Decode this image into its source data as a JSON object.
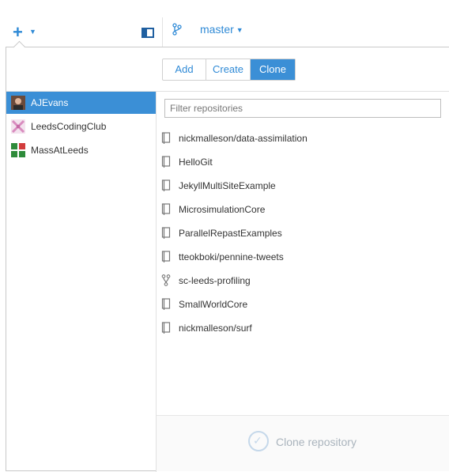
{
  "toolbar": {
    "branch_label": "master"
  },
  "tabs": [
    {
      "label": "Add"
    },
    {
      "label": "Create"
    },
    {
      "label": "Clone"
    }
  ],
  "accounts": [
    {
      "name": "AJEvans",
      "selected": true
    },
    {
      "name": "LeedsCodingClub",
      "selected": false
    },
    {
      "name": "MassAtLeeds",
      "selected": false
    }
  ],
  "filter": {
    "placeholder": "Filter repositories",
    "value": ""
  },
  "repositories": [
    {
      "name": "nickmalleson/data-assimilation",
      "icon": "repo-icon"
    },
    {
      "name": "HelloGit",
      "icon": "repo-icon"
    },
    {
      "name": "JekyllMultiSiteExample",
      "icon": "repo-icon"
    },
    {
      "name": "MicrosimulationCore",
      "icon": "repo-icon"
    },
    {
      "name": "ParallelRepastExamples",
      "icon": "repo-icon"
    },
    {
      "name": "tteokboki/pennine-tweets",
      "icon": "repo-icon"
    },
    {
      "name": "sc-leeds-profiling",
      "icon": "fork-icon"
    },
    {
      "name": "SmallWorldCore",
      "icon": "repo-icon"
    },
    {
      "name": "nickmalleson/surf",
      "icon": "repo-icon"
    }
  ],
  "footer": {
    "clone_label": "Clone repository"
  },
  "colors": {
    "accent": "#3b8fd6",
    "link": "#2f8ad6",
    "disabled": "#aab4bd"
  }
}
